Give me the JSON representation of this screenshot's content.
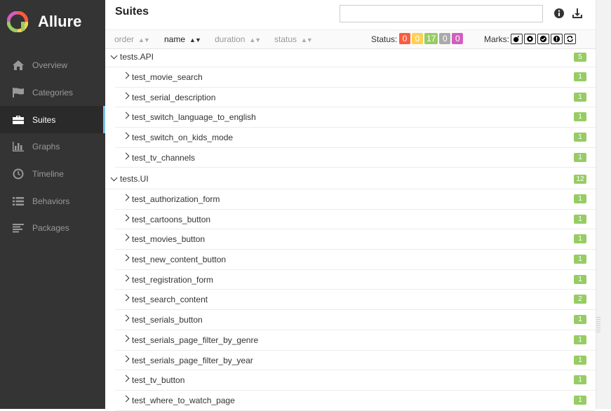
{
  "app": {
    "name": "Allure"
  },
  "nav": [
    {
      "label": "Overview",
      "icon": "home-icon"
    },
    {
      "label": "Categories",
      "icon": "flag-icon"
    },
    {
      "label": "Suites",
      "icon": "briefcase-icon",
      "active": true
    },
    {
      "label": "Graphs",
      "icon": "bar-chart-icon"
    },
    {
      "label": "Timeline",
      "icon": "clock-icon"
    },
    {
      "label": "Behaviors",
      "icon": "list-icon"
    },
    {
      "label": "Packages",
      "icon": "align-left-icon"
    }
  ],
  "page": {
    "title": "Suites",
    "search_placeholder": ""
  },
  "sort": {
    "order": "order",
    "name": "name",
    "duration": "duration",
    "status": "status"
  },
  "status": {
    "label": "Status:",
    "counts": [
      {
        "value": "0",
        "color": "#fd5a3e"
      },
      {
        "value": "0",
        "color": "#ffd050"
      },
      {
        "value": "17",
        "color": "#97cc64"
      },
      {
        "value": "0",
        "color": "#aaaaaa"
      },
      {
        "value": "0",
        "color": "#d35ebe"
      }
    ]
  },
  "marks": {
    "label": "Marks:",
    "icons": [
      "bomb-icon",
      "gear-icon",
      "check-icon",
      "info-icon",
      "refresh-icon"
    ]
  },
  "groups": [
    {
      "name": "tests.API",
      "count": "5",
      "tests": [
        {
          "name": "test_movie_search",
          "count": "1"
        },
        {
          "name": "test_serial_description",
          "count": "1"
        },
        {
          "name": "test_switch_language_to_english",
          "count": "1"
        },
        {
          "name": "test_switch_on_kids_mode",
          "count": "1"
        },
        {
          "name": "test_tv_channels",
          "count": "1"
        }
      ]
    },
    {
      "name": "tests.UI",
      "count": "12",
      "tests": [
        {
          "name": "test_authorization_form",
          "count": "1"
        },
        {
          "name": "test_cartoons_button",
          "count": "1"
        },
        {
          "name": "test_movies_button",
          "count": "1"
        },
        {
          "name": "test_new_content_button",
          "count": "1"
        },
        {
          "name": "test_registration_form",
          "count": "1"
        },
        {
          "name": "test_search_content",
          "count": "2"
        },
        {
          "name": "test_serials_button",
          "count": "1"
        },
        {
          "name": "test_serials_page_filter_by_genre",
          "count": "1"
        },
        {
          "name": "test_serials_page_filter_by_year",
          "count": "1"
        },
        {
          "name": "test_tv_button",
          "count": "1"
        },
        {
          "name": "test_where_to_watch_page",
          "count": "1"
        }
      ]
    }
  ]
}
